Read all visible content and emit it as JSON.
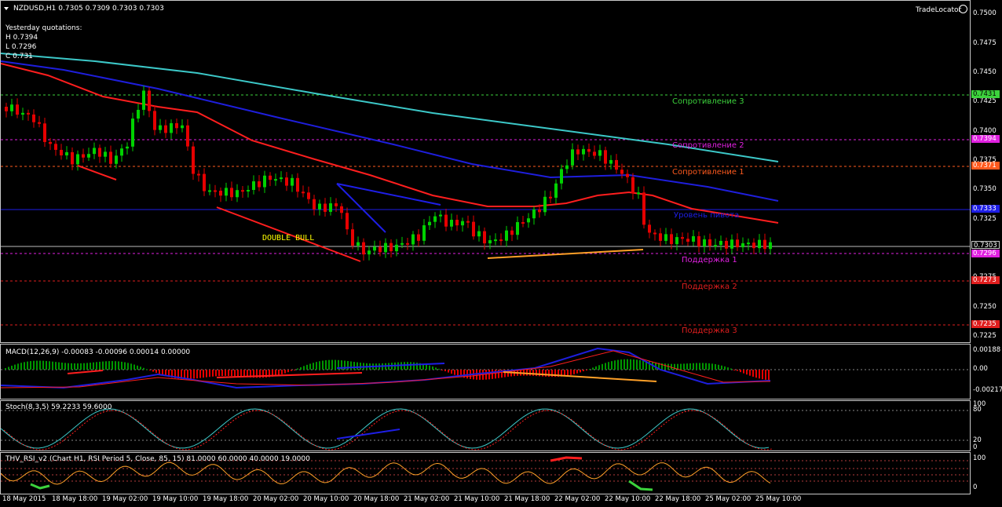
{
  "header": {
    "symbol_line": "NZDUSD,H1  0.7305 0.7309 0.7303 0.7303",
    "yesterday_title": "Yesterday quotations:",
    "yesterday_high": "H 0.7394",
    "yesterday_low": "L 0.7296",
    "yesterday_close": "C 0.731",
    "trade_locator": "TradeLocator"
  },
  "price_scale": {
    "ticks": [
      "0.7500",
      "0.7475",
      "0.7450",
      "0.7425",
      "0.7400",
      "0.7375",
      "0.7350",
      "0.7325",
      "0.7275",
      "0.7250",
      "0.7225"
    ],
    "current_price": "0.7303"
  },
  "levels": [
    {
      "label": "Сопротивление 3",
      "price": "0.7431",
      "color": "#3cd23c"
    },
    {
      "label": "Сопротивление 2",
      "price": "0.7394",
      "color": "#e020e0"
    },
    {
      "label": "Сопротивление 1",
      "price": "0.7371",
      "color": "#ff5a1e"
    },
    {
      "label": "Уровень пивота",
      "price": "0.7333",
      "color": "#1e1ee6"
    },
    {
      "label": "Поддержка 1",
      "price": "0.7296",
      "color": "#e020e0"
    },
    {
      "label": "Поддержка 2",
      "price": "0.7273",
      "color": "#e01e1e"
    },
    {
      "label": "Поддержка 3",
      "price": "0.7235",
      "color": "#e01e1e"
    }
  ],
  "annotation": "DOUBLE BULL",
  "macd": {
    "title": "MACD(12,26,9) -0.00083 -0.00096 0.00014 0.00000",
    "ticks": [
      "0.00188",
      "0.00",
      "-0.00217"
    ]
  },
  "stoch": {
    "title": "Stoch(8,3,5) 59.2233 59.6000",
    "ticks": [
      "100",
      "80",
      "20",
      "0"
    ]
  },
  "rsi": {
    "title": "THV_RSI_v2  (Chart H1,  RSI Period 5,  Close,  85,  15)  81.0000 60.0000 40.0000 19.0000",
    "ticks": [
      "100",
      "0"
    ]
  },
  "time_axis": [
    "18 May 2015",
    "18 May 18:00",
    "19 May 02:00",
    "19 May 10:00",
    "19 May 18:00",
    "20 May 02:00",
    "20 May 10:00",
    "20 May 18:00",
    "21 May 02:00",
    "21 May 10:00",
    "21 May 18:00",
    "22 May 02:00",
    "22 May 10:00",
    "22 May 18:00",
    "25 May 02:00",
    "25 May 10:00"
  ],
  "colors": {
    "bull_candle": "#00d200",
    "bear_candle": "#e60000",
    "ema_red": "#ff1e1e",
    "ema_blue": "#1e1edc",
    "ema_cyan": "#3cc8c8"
  }
}
